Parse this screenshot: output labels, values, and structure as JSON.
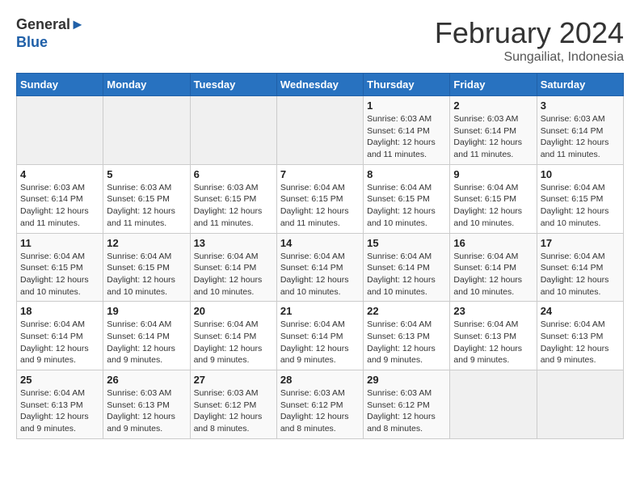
{
  "header": {
    "logo_line1": "General",
    "logo_line2": "Blue",
    "title": "February 2024",
    "subtitle": "Sungailiat, Indonesia"
  },
  "days_of_week": [
    "Sunday",
    "Monday",
    "Tuesday",
    "Wednesday",
    "Thursday",
    "Friday",
    "Saturday"
  ],
  "weeks": [
    [
      {
        "day": "",
        "info": ""
      },
      {
        "day": "",
        "info": ""
      },
      {
        "day": "",
        "info": ""
      },
      {
        "day": "",
        "info": ""
      },
      {
        "day": "1",
        "info": "Sunrise: 6:03 AM\nSunset: 6:14 PM\nDaylight: 12 hours and 11 minutes."
      },
      {
        "day": "2",
        "info": "Sunrise: 6:03 AM\nSunset: 6:14 PM\nDaylight: 12 hours and 11 minutes."
      },
      {
        "day": "3",
        "info": "Sunrise: 6:03 AM\nSunset: 6:14 PM\nDaylight: 12 hours and 11 minutes."
      }
    ],
    [
      {
        "day": "4",
        "info": "Sunrise: 6:03 AM\nSunset: 6:14 PM\nDaylight: 12 hours and 11 minutes."
      },
      {
        "day": "5",
        "info": "Sunrise: 6:03 AM\nSunset: 6:15 PM\nDaylight: 12 hours and 11 minutes."
      },
      {
        "day": "6",
        "info": "Sunrise: 6:03 AM\nSunset: 6:15 PM\nDaylight: 12 hours and 11 minutes."
      },
      {
        "day": "7",
        "info": "Sunrise: 6:04 AM\nSunset: 6:15 PM\nDaylight: 12 hours and 11 minutes."
      },
      {
        "day": "8",
        "info": "Sunrise: 6:04 AM\nSunset: 6:15 PM\nDaylight: 12 hours and 10 minutes."
      },
      {
        "day": "9",
        "info": "Sunrise: 6:04 AM\nSunset: 6:15 PM\nDaylight: 12 hours and 10 minutes."
      },
      {
        "day": "10",
        "info": "Sunrise: 6:04 AM\nSunset: 6:15 PM\nDaylight: 12 hours and 10 minutes."
      }
    ],
    [
      {
        "day": "11",
        "info": "Sunrise: 6:04 AM\nSunset: 6:15 PM\nDaylight: 12 hours and 10 minutes."
      },
      {
        "day": "12",
        "info": "Sunrise: 6:04 AM\nSunset: 6:15 PM\nDaylight: 12 hours and 10 minutes."
      },
      {
        "day": "13",
        "info": "Sunrise: 6:04 AM\nSunset: 6:14 PM\nDaylight: 12 hours and 10 minutes."
      },
      {
        "day": "14",
        "info": "Sunrise: 6:04 AM\nSunset: 6:14 PM\nDaylight: 12 hours and 10 minutes."
      },
      {
        "day": "15",
        "info": "Sunrise: 6:04 AM\nSunset: 6:14 PM\nDaylight: 12 hours and 10 minutes."
      },
      {
        "day": "16",
        "info": "Sunrise: 6:04 AM\nSunset: 6:14 PM\nDaylight: 12 hours and 10 minutes."
      },
      {
        "day": "17",
        "info": "Sunrise: 6:04 AM\nSunset: 6:14 PM\nDaylight: 12 hours and 10 minutes."
      }
    ],
    [
      {
        "day": "18",
        "info": "Sunrise: 6:04 AM\nSunset: 6:14 PM\nDaylight: 12 hours and 9 minutes."
      },
      {
        "day": "19",
        "info": "Sunrise: 6:04 AM\nSunset: 6:14 PM\nDaylight: 12 hours and 9 minutes."
      },
      {
        "day": "20",
        "info": "Sunrise: 6:04 AM\nSunset: 6:14 PM\nDaylight: 12 hours and 9 minutes."
      },
      {
        "day": "21",
        "info": "Sunrise: 6:04 AM\nSunset: 6:14 PM\nDaylight: 12 hours and 9 minutes."
      },
      {
        "day": "22",
        "info": "Sunrise: 6:04 AM\nSunset: 6:13 PM\nDaylight: 12 hours and 9 minutes."
      },
      {
        "day": "23",
        "info": "Sunrise: 6:04 AM\nSunset: 6:13 PM\nDaylight: 12 hours and 9 minutes."
      },
      {
        "day": "24",
        "info": "Sunrise: 6:04 AM\nSunset: 6:13 PM\nDaylight: 12 hours and 9 minutes."
      }
    ],
    [
      {
        "day": "25",
        "info": "Sunrise: 6:04 AM\nSunset: 6:13 PM\nDaylight: 12 hours and 9 minutes."
      },
      {
        "day": "26",
        "info": "Sunrise: 6:03 AM\nSunset: 6:13 PM\nDaylight: 12 hours and 9 minutes."
      },
      {
        "day": "27",
        "info": "Sunrise: 6:03 AM\nSunset: 6:12 PM\nDaylight: 12 hours and 8 minutes."
      },
      {
        "day": "28",
        "info": "Sunrise: 6:03 AM\nSunset: 6:12 PM\nDaylight: 12 hours and 8 minutes."
      },
      {
        "day": "29",
        "info": "Sunrise: 6:03 AM\nSunset: 6:12 PM\nDaylight: 12 hours and 8 minutes."
      },
      {
        "day": "",
        "info": ""
      },
      {
        "day": "",
        "info": ""
      }
    ]
  ]
}
